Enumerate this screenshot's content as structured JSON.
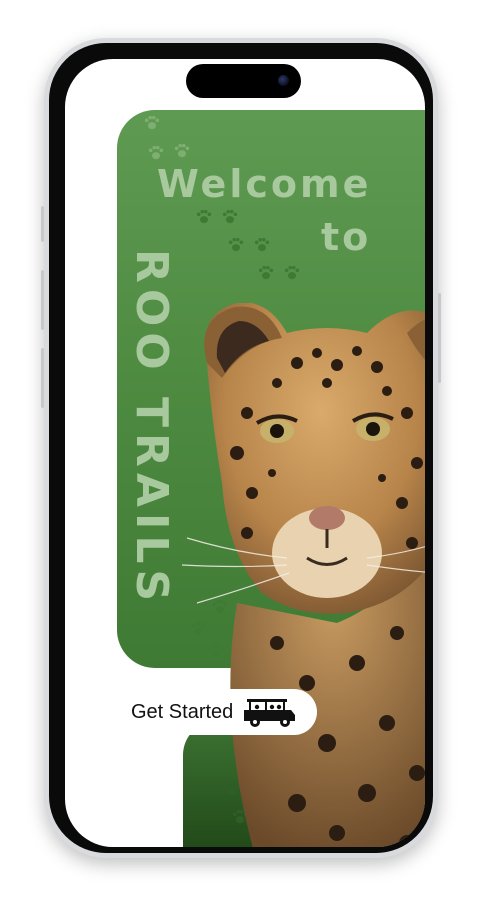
{
  "splash": {
    "welcome": "Welcome",
    "to": "to",
    "app_name": "ROO TRAILS"
  },
  "cta": {
    "label": "Get Started",
    "icon": "safari-jeep-icon"
  },
  "colors": {
    "panel_green": "#4f8c42",
    "title_text": "#a8c99d"
  }
}
